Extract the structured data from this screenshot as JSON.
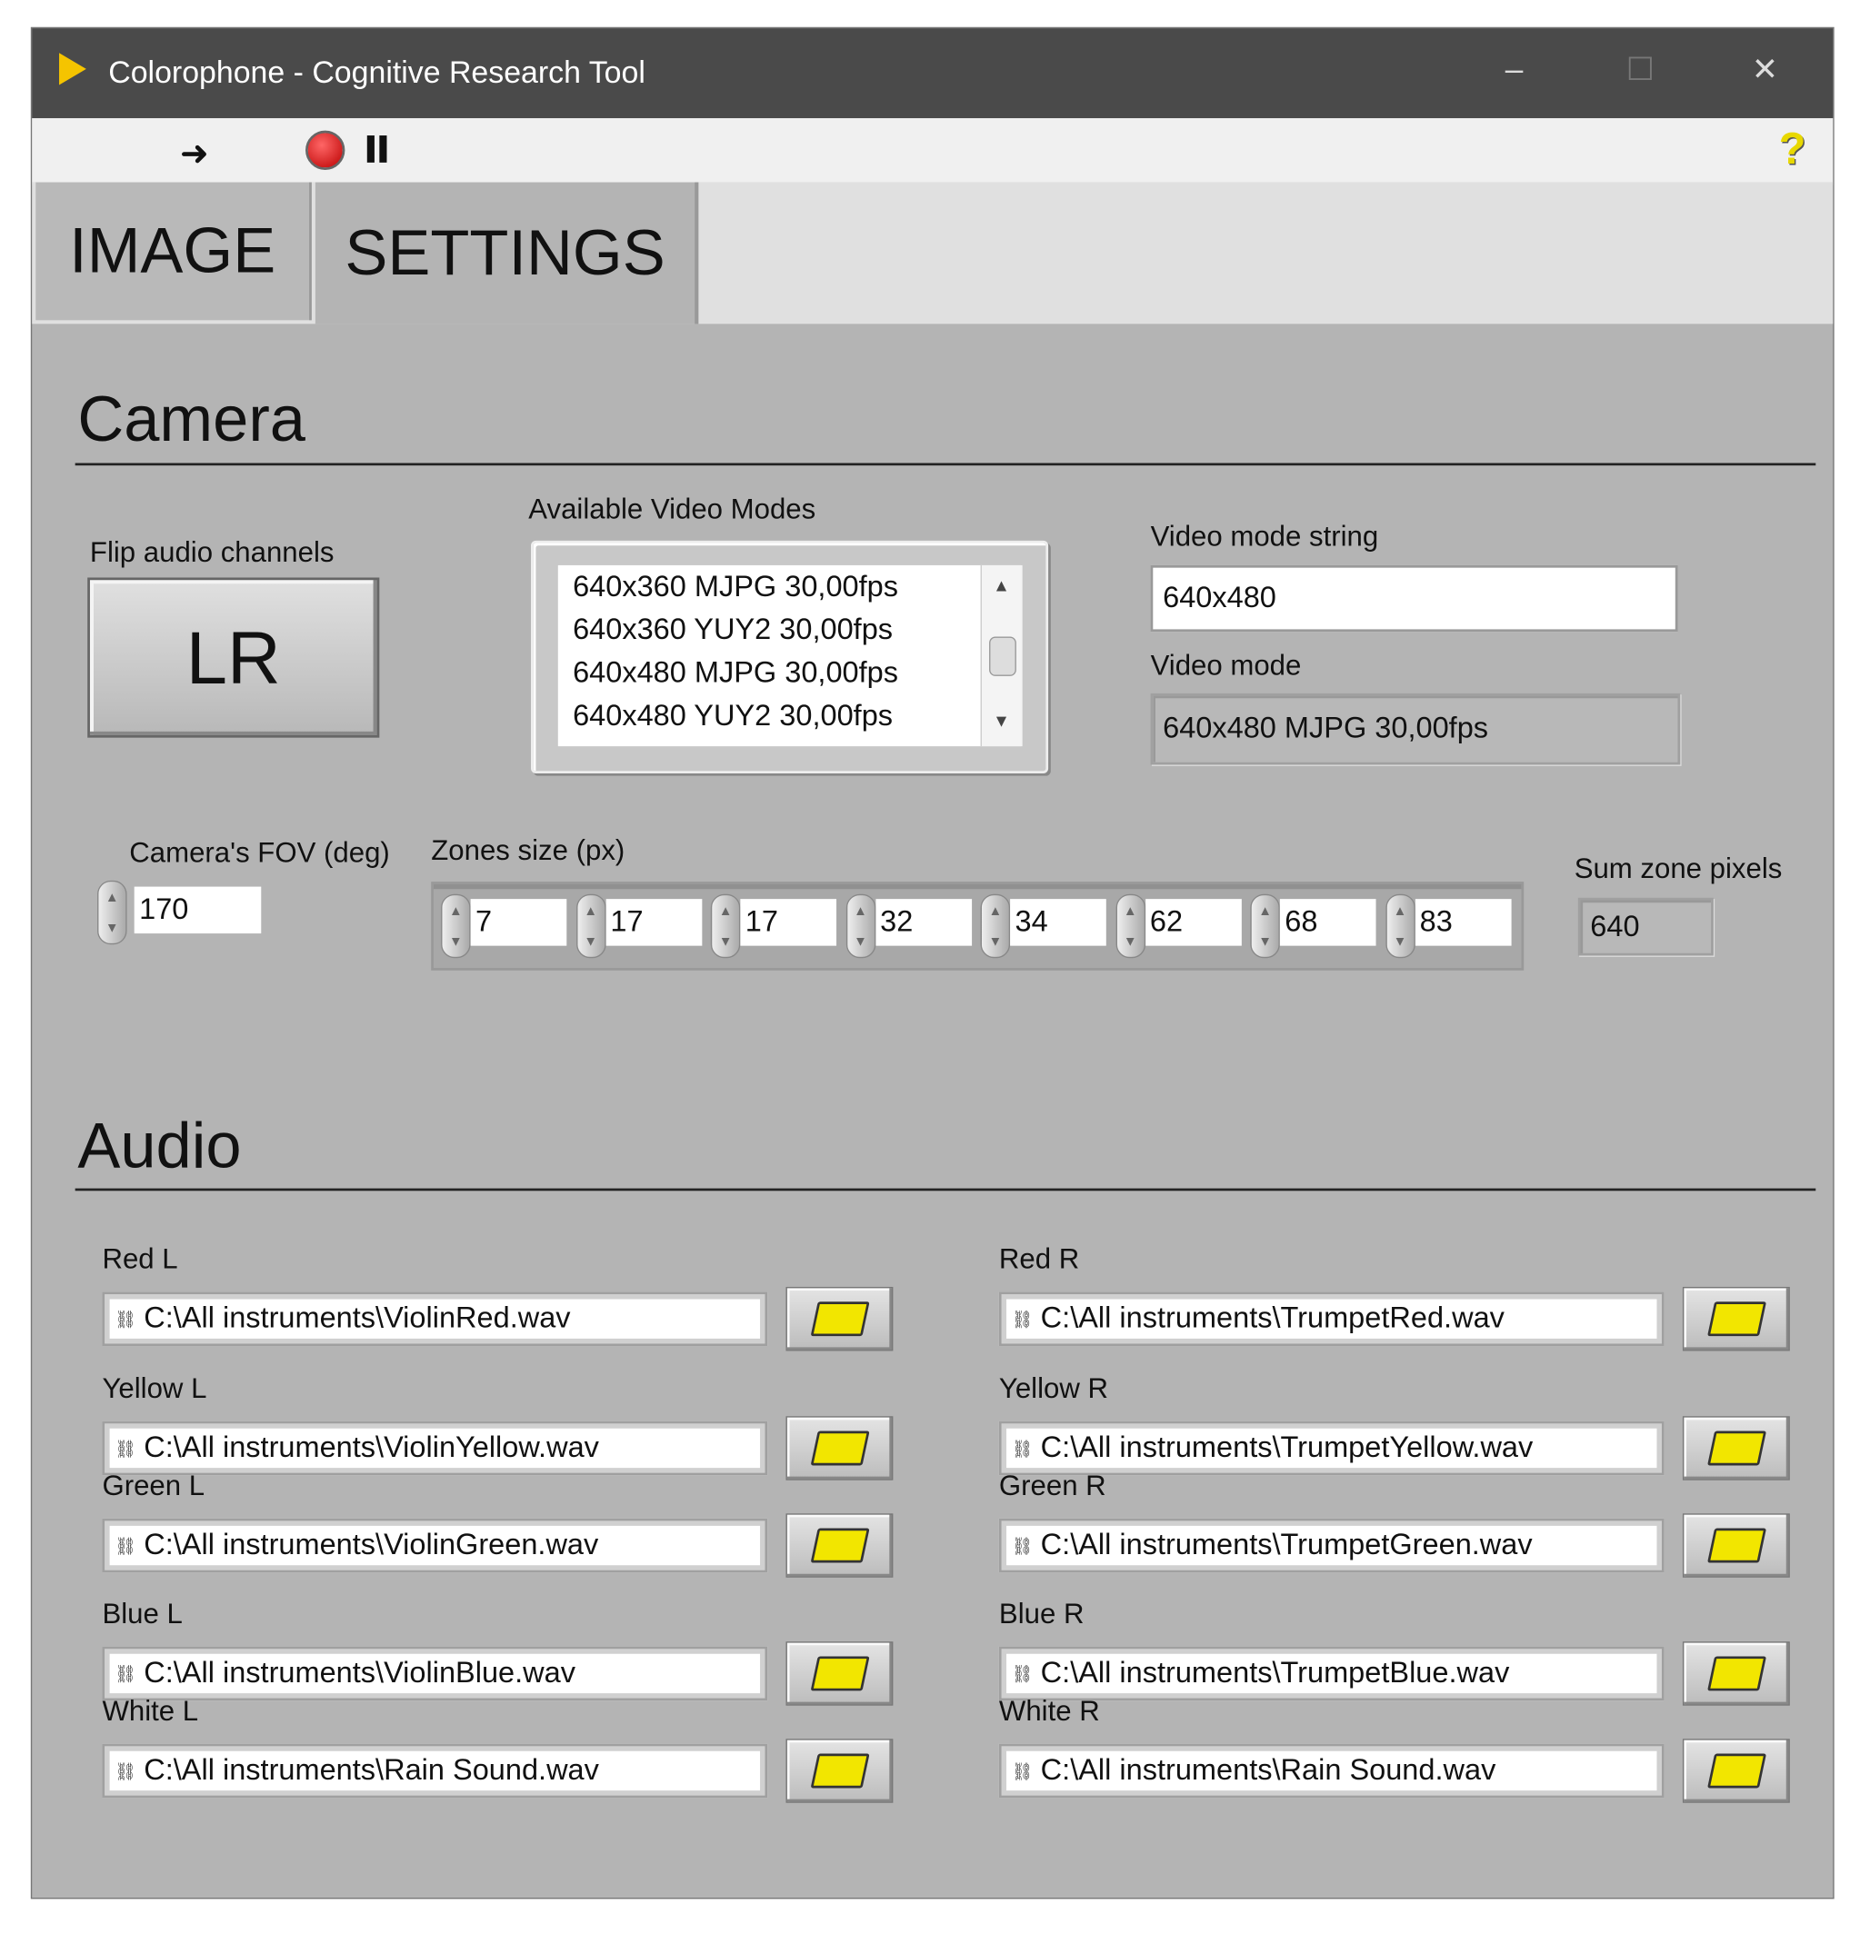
{
  "window": {
    "title": "Colorophone - Cognitive Research Tool",
    "minimize": "–",
    "maximize": "☐",
    "close": "✕"
  },
  "toolbar": {
    "run_icon": "arrow-right",
    "stop_icon": "stop",
    "pause_icon": "pause",
    "help": "?"
  },
  "tabs": [
    {
      "label": "IMAGE",
      "selected": false
    },
    {
      "label": "SETTINGS",
      "selected": true
    }
  ],
  "camera": {
    "heading": "Camera",
    "flip_label": "Flip audio channels",
    "flip_value": "LR",
    "modes_label": "Available Video Modes",
    "modes": [
      "640x360 MJPG 30,00fps",
      "640x360 YUY2 30,00fps",
      "640x480 MJPG 30,00fps",
      "640x480 YUY2 30,00fps"
    ],
    "mode_string_label": "Video mode string",
    "mode_string": "640x480",
    "mode_label": "Video mode",
    "mode": "640x480 MJPG 30,00fps",
    "fov_label": "Camera's FOV (deg)",
    "fov": "170",
    "zones_label": "Zones size (px)",
    "zones": [
      "7",
      "17",
      "17",
      "32",
      "34",
      "62",
      "68",
      "83"
    ],
    "sum_label": "Sum zone pixels",
    "sum": "640"
  },
  "audio": {
    "heading": "Audio",
    "left": [
      {
        "label": "Red L",
        "path": "C:\\All instruments\\ViolinRed.wav"
      },
      {
        "label": "Yellow L",
        "path": "C:\\All instruments\\ViolinYellow.wav"
      },
      {
        "label": "Green L",
        "path": "C:\\All instruments\\ViolinGreen.wav"
      },
      {
        "label": "Blue L",
        "path": "C:\\All instruments\\ViolinBlue.wav"
      },
      {
        "label": "White L",
        "path": "C:\\All instruments\\Rain Sound.wav"
      }
    ],
    "right": [
      {
        "label": "Red R",
        "path": "C:\\All instruments\\TrumpetRed.wav"
      },
      {
        "label": "Yellow R",
        "path": "C:\\All instruments\\TrumpetYellow.wav"
      },
      {
        "label": "Green R",
        "path": "C:\\All instruments\\TrumpetGreen.wav"
      },
      {
        "label": "Blue R",
        "path": "C:\\All instruments\\TrumpetBlue.wav"
      },
      {
        "label": "White R",
        "path": "C:\\All instruments\\Rain Sound.wav"
      }
    ]
  }
}
